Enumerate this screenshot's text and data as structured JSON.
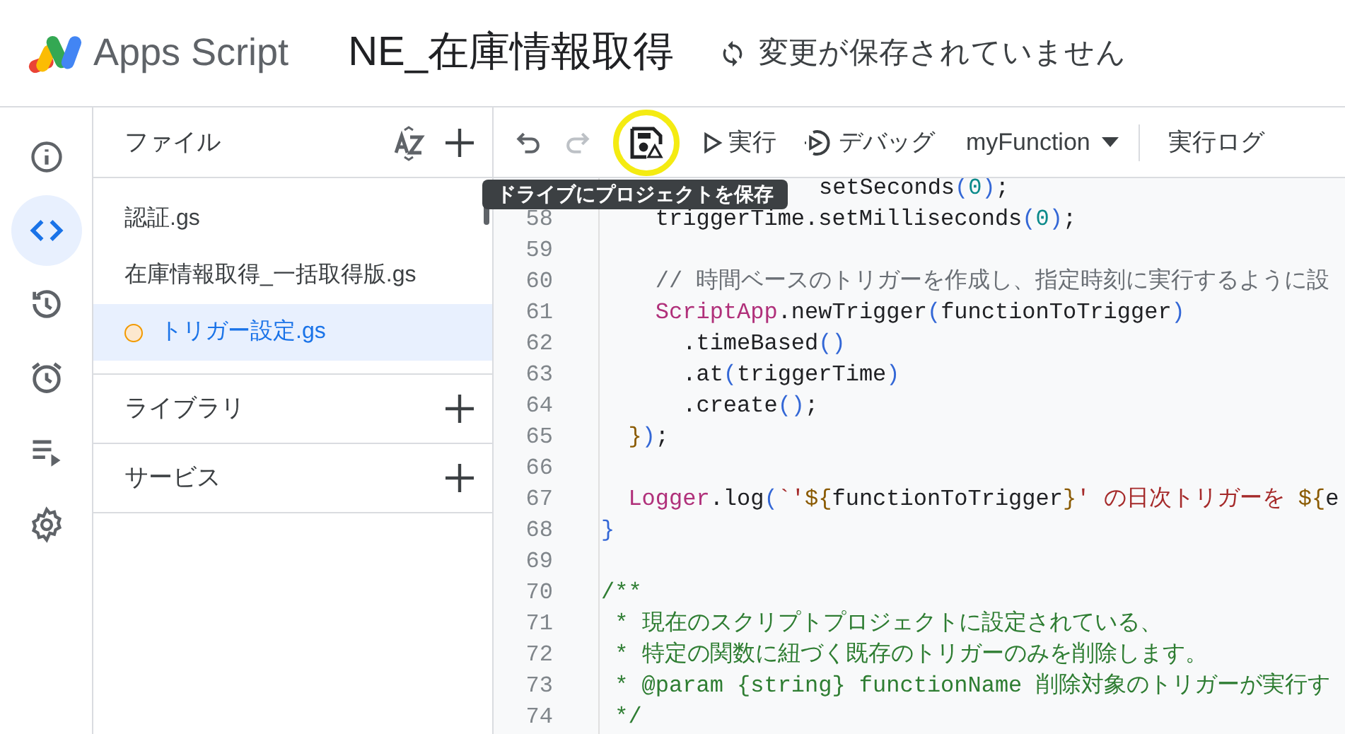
{
  "header": {
    "product": "Apps Script",
    "project_title": "NE_在庫情報取得",
    "save_status": "変更が保存されていません"
  },
  "rail": [
    {
      "selected": false
    },
    {
      "selected": true
    },
    {
      "selected": false
    },
    {
      "selected": false
    },
    {
      "selected": false
    },
    {
      "selected": false
    }
  ],
  "files_panel": {
    "title": "ファイル",
    "files": [
      {
        "name": "認証.gs",
        "selected": false,
        "unsaved": false
      },
      {
        "name": "在庫情報取得_一括取得版.gs",
        "selected": false,
        "unsaved": false
      },
      {
        "name": "トリガー設定.gs",
        "selected": true,
        "unsaved": true
      }
    ],
    "sections": [
      "ライブラリ",
      "サービス"
    ]
  },
  "toolbar": {
    "undo_disabled": false,
    "redo_disabled": true,
    "run": "実行",
    "debug": "デバッグ",
    "function": "myFunction",
    "log": "実行ログ",
    "tooltip": "ドライブにプロジェクトを保存"
  },
  "code_lines": [
    {
      "covered_by_tooltip": true,
      "tokens": [
        {
          "kind": "plain",
          "text": "setSeconds"
        },
        {
          "kind": "paren",
          "text": "("
        },
        {
          "kind": "number",
          "text": "0"
        },
        {
          "kind": "paren",
          "text": ")"
        },
        {
          "kind": "plain",
          "text": ";"
        }
      ]
    },
    {
      "number": "58",
      "tokens": [
        {
          "kind": "plain",
          "text": "    triggerTime.setMilliseconds"
        },
        {
          "kind": "paren",
          "text": "("
        },
        {
          "kind": "number",
          "text": "0"
        },
        {
          "kind": "paren",
          "text": ")"
        },
        {
          "kind": "plain",
          "text": ";"
        }
      ]
    },
    {
      "number": "59"
    },
    {
      "number": "60",
      "tokens": [
        {
          "kind": "comment",
          "text": "    // 時間ベースのトリガーを作成し、指定時刻に実行するように設"
        }
      ]
    },
    {
      "number": "61",
      "tokens": [
        {
          "kind": "class",
          "text": "    ScriptApp"
        },
        {
          "kind": "plain",
          "text": ".newTrigger"
        },
        {
          "kind": "paren",
          "text": "("
        },
        {
          "kind": "plain",
          "text": "functionToTrigger"
        },
        {
          "kind": "paren",
          "text": ")"
        }
      ]
    },
    {
      "number": "62",
      "tokens": [
        {
          "kind": "plain",
          "text": "      .timeBased"
        },
        {
          "kind": "paren",
          "text": "()"
        }
      ]
    },
    {
      "number": "63",
      "tokens": [
        {
          "kind": "plain",
          "text": "      .at"
        },
        {
          "kind": "paren",
          "text": "("
        },
        {
          "kind": "plain",
          "text": "triggerTime"
        },
        {
          "kind": "paren",
          "text": ")"
        }
      ]
    },
    {
      "number": "64",
      "tokens": [
        {
          "kind": "plain",
          "text": "      .create"
        },
        {
          "kind": "paren",
          "text": "()"
        },
        {
          "kind": "plain",
          "text": ";"
        }
      ]
    },
    {
      "number": "65",
      "tokens": [
        {
          "kind": "bracket",
          "text": "  }"
        },
        {
          "kind": "paren",
          "text": ")"
        },
        {
          "kind": "plain",
          "text": ";"
        }
      ]
    },
    {
      "number": "66"
    },
    {
      "number": "67",
      "tokens": [
        {
          "kind": "class",
          "text": "  Logger"
        },
        {
          "kind": "plain",
          "text": ".log"
        },
        {
          "kind": "paren",
          "text": "("
        },
        {
          "kind": "string",
          "text": "`'"
        },
        {
          "kind": "bracket",
          "text": "${"
        },
        {
          "kind": "plain",
          "text": "functionToTrigger"
        },
        {
          "kind": "bracket",
          "text": "}"
        },
        {
          "kind": "string",
          "text": "' の日次トリガーを "
        },
        {
          "kind": "bracket",
          "text": "${"
        },
        {
          "kind": "plain",
          "text": "e"
        }
      ]
    },
    {
      "number": "68",
      "tokens": [
        {
          "kind": "paren",
          "text": "}"
        }
      ]
    },
    {
      "number": "69"
    },
    {
      "number": "70",
      "tokens": [
        {
          "kind": "doc",
          "text": "/**"
        }
      ]
    },
    {
      "number": "71",
      "tokens": [
        {
          "kind": "doc",
          "text": " * 現在のスクリプトプロジェクトに設定されている、"
        }
      ]
    },
    {
      "number": "72",
      "tokens": [
        {
          "kind": "doc",
          "text": " * 特定の関数に紐づく既存のトリガーのみを削除します。"
        }
      ]
    },
    {
      "number": "73",
      "tokens": [
        {
          "kind": "doc",
          "text": " * @param {string} functionName 削除対象のトリガーが実行す"
        }
      ]
    },
    {
      "number": "74",
      "tokens": [
        {
          "kind": "doc",
          "text": " */"
        }
      ]
    }
  ]
}
